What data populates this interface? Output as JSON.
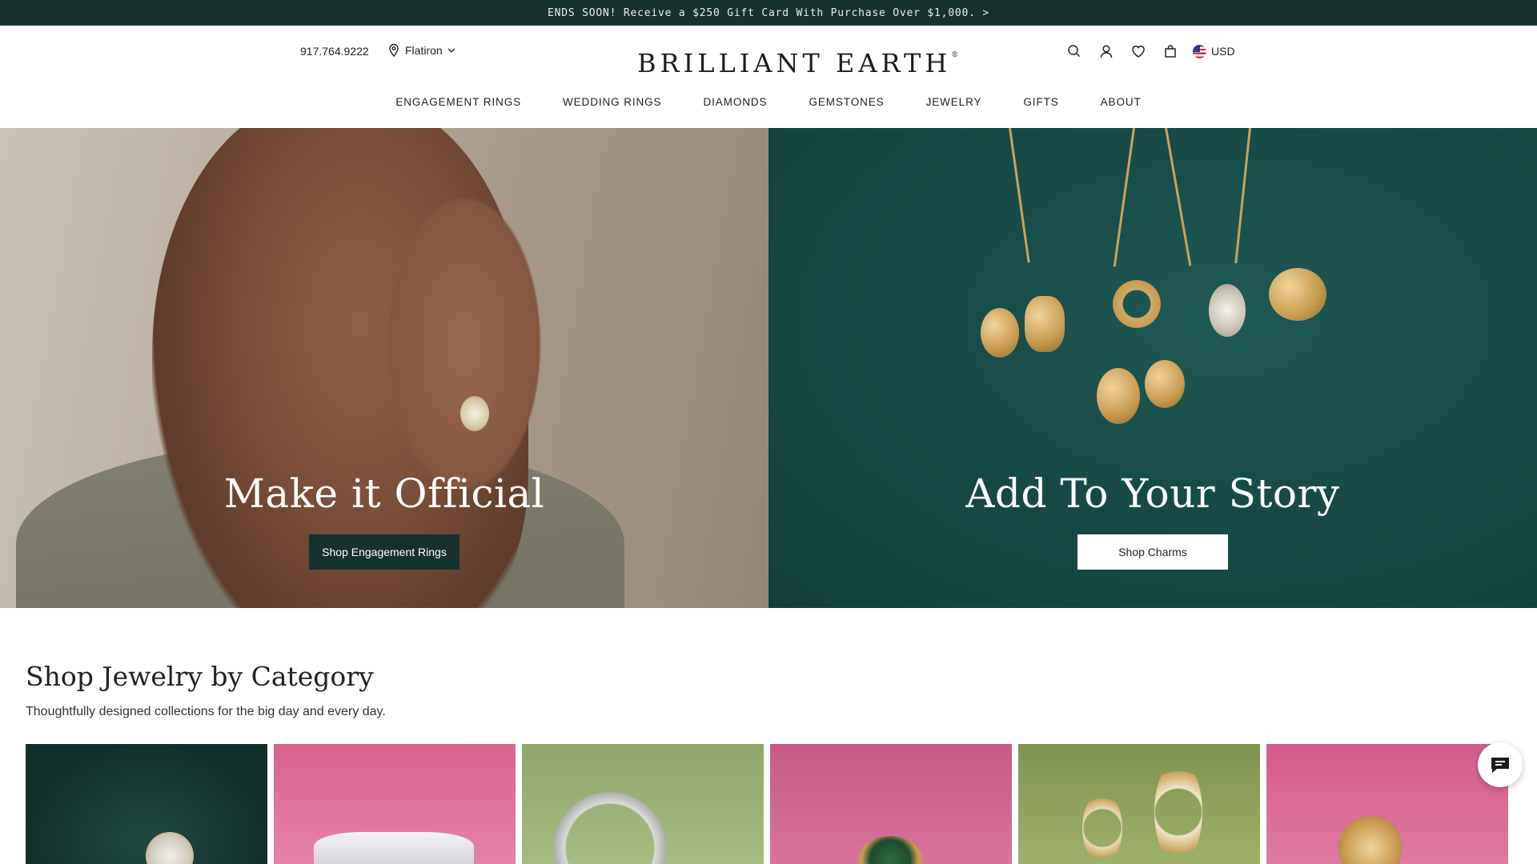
{
  "promo": {
    "text": "ENDS SOON! Receive a $250 Gift Card With Purchase Over $1,000. >"
  },
  "header": {
    "phone": "917.764.9222",
    "location": "Flatiron",
    "logo": "BRILLIANT EARTH",
    "logo_mark": "®",
    "currency": "USD",
    "icons": [
      "search-icon",
      "account-icon",
      "heart-icon",
      "bag-icon"
    ]
  },
  "nav": {
    "items": [
      "ENGAGEMENT RINGS",
      "WEDDING RINGS",
      "DIAMONDS",
      "GEMSTONES",
      "JEWELRY",
      "GIFTS",
      "ABOUT"
    ]
  },
  "hero": {
    "left": {
      "title": "Make it Official",
      "button": "Shop Engagement Rings"
    },
    "right": {
      "title": "Add To Your Story",
      "button": "Shop Charms"
    }
  },
  "category_section": {
    "title": "Shop Jewelry by Category",
    "subtitle": "Thoughtfully designed collections for the big day and every day."
  },
  "colors": {
    "brand_dark": "#17312f",
    "hero_right_bg": "#174b47",
    "white": "#ffffff"
  }
}
